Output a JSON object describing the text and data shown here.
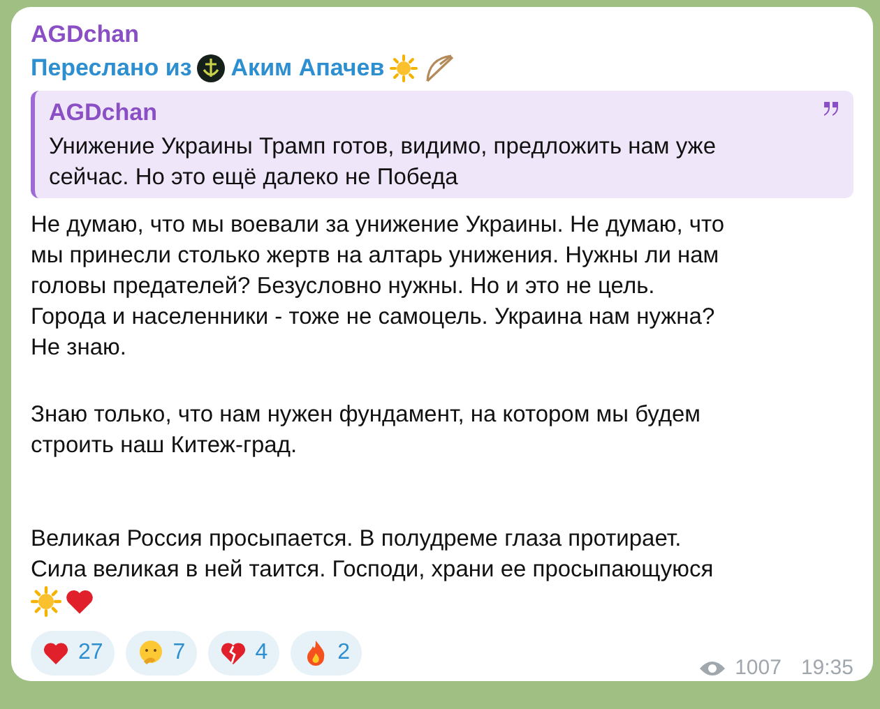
{
  "message": {
    "author": "AGDchan",
    "forwarded_label": "Переслано из",
    "forwarded_from": "Аким Апачев",
    "quote": {
      "author": "AGDchan",
      "text": "Унижение Украины Трамп готов, видимо, предложить нам уже\nсейчас. Но это ещё далеко не Победа"
    },
    "paragraphs": [
      "Не думаю, что мы воевали за унижение Украины. Не думаю, что\nмы принесли столько жертв на алтарь унижения. Нужны ли нам\nголовы предателей? Безусловно нужны. Но и это не цель.\nГорода и населенники - тоже не самоцель. Украина нам нужна?\nНе знаю.",
      "Знаю только, что нам нужен фундамент, на котором мы будем\nстроить наш Китеж-град.",
      "Великая Россия просыпается. В полудреме глаза протирает.\nСила великая в ней таится. Господи, храни ее просыпающуюся"
    ],
    "reactions": [
      {
        "kind": "heart",
        "count": "27"
      },
      {
        "kind": "thinking",
        "count": "7"
      },
      {
        "kind": "broken-heart",
        "count": "4"
      },
      {
        "kind": "fire",
        "count": "2"
      }
    ],
    "views": "1007",
    "time": "19:35"
  }
}
